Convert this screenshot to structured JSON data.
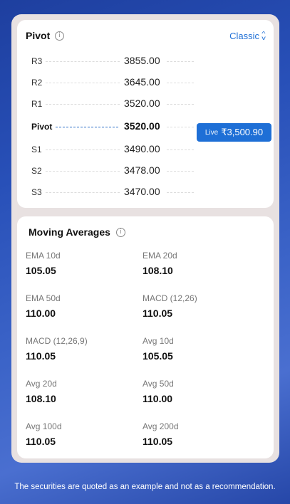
{
  "pivot": {
    "title": "Pivot",
    "mode": "Classic",
    "levels": [
      {
        "label": "R3",
        "value": "3855.00"
      },
      {
        "label": "R2",
        "value": "3645.00"
      },
      {
        "label": "R1",
        "value": "3520.00"
      },
      {
        "label": "Pivot",
        "value": "3520.00"
      },
      {
        "label": "S1",
        "value": "3490.00"
      },
      {
        "label": "S2",
        "value": "3478.00"
      },
      {
        "label": "S3",
        "value": "3470.00"
      }
    ],
    "live_label": "Live",
    "live_price": "₹3,500.90"
  },
  "moving_averages": {
    "title": "Moving Averages",
    "items": [
      {
        "name": "EMA 10d",
        "value": "105.05"
      },
      {
        "name": "EMA 20d",
        "value": "108.10"
      },
      {
        "name": "EMA 50d",
        "value": "110.00"
      },
      {
        "name": "MACD (12,26)",
        "value": "110.05"
      },
      {
        "name": "MACD (12,26,9)",
        "value": "110.05"
      },
      {
        "name": "Avg 10d",
        "value": "105.05"
      },
      {
        "name": "Avg 20d",
        "value": "108.10"
      },
      {
        "name": "Avg 50d",
        "value": "110.00"
      },
      {
        "name": "Avg 100d",
        "value": "110.05"
      },
      {
        "name": "Avg 200d",
        "value": "110.05"
      }
    ]
  },
  "info_icon_glyph": "i",
  "disclaimer": "The securities are quoted as an example and not as a recommendation."
}
